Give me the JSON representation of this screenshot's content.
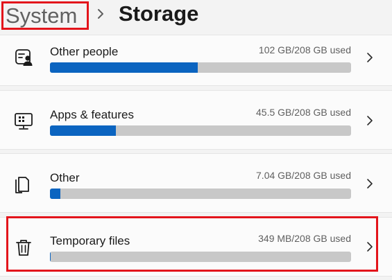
{
  "breadcrumb": {
    "parent": "System",
    "current": "Storage"
  },
  "colors": {
    "accent": "#0b64c0",
    "highlight": "#e3141b",
    "track": "#c8c8c8"
  },
  "categories": [
    {
      "title": "Other people",
      "usage": "102 GB/208 GB used",
      "fraction_used": 0.49,
      "icon": "person-card-icon"
    },
    {
      "title": "Apps & features",
      "usage": "45.5 GB/208 GB used",
      "fraction_used": 0.219,
      "icon": "apps-monitor-icon"
    },
    {
      "title": "Other",
      "usage": "7.04 GB/208 GB used",
      "fraction_used": 0.034,
      "icon": "document-icon"
    },
    {
      "title": "Temporary files",
      "usage": "349 MB/208 GB used",
      "fraction_used": 0.002,
      "icon": "trash-icon"
    }
  ]
}
